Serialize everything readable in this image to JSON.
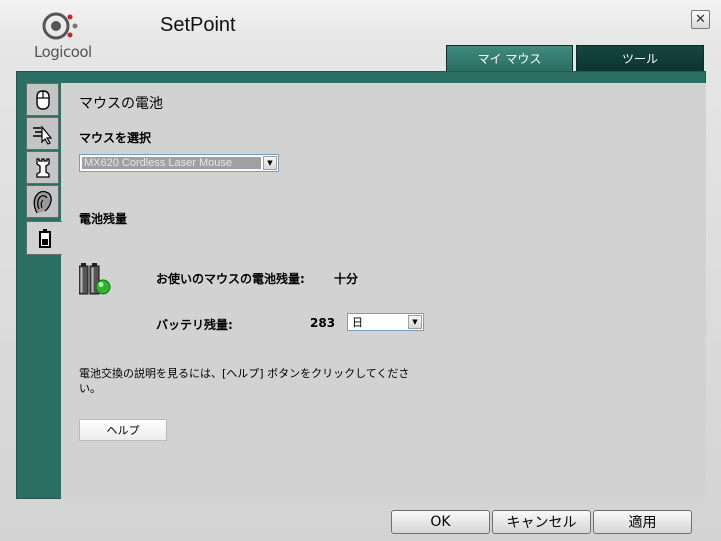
{
  "app": {
    "logo_text": "Logicool",
    "title": "SetPoint"
  },
  "tabs": [
    {
      "label": "マイ マウス",
      "active": true
    },
    {
      "label": "ツール",
      "active": false
    }
  ],
  "side_nav": [
    {
      "icon": "mouse-icon"
    },
    {
      "icon": "pointer-icon"
    },
    {
      "icon": "chess-rook-icon"
    },
    {
      "icon": "hand-icon"
    },
    {
      "icon": "battery-icon",
      "active": true
    }
  ],
  "page": {
    "title": "マウスの電池",
    "select_mouse_label": "マウスを選択",
    "selected_mouse": "MX620 Cordless Laser Mouse",
    "battery_section_label": "電池残量",
    "battery_status_label": "お使いのマウスの電池残量:",
    "battery_status_value": "十分",
    "battery_remaining_label": "バッテリ残量:",
    "battery_remaining_value": "283",
    "battery_unit": "日",
    "instructions_line1": "電池交換の説明を見るには、[ヘルプ] ボタンをクリックしてくださ",
    "instructions_line2": "い。",
    "help_button": "ヘルプ"
  },
  "footer": {
    "ok": "OK",
    "cancel": "キャンセル",
    "apply": "適用"
  },
  "colors": {
    "frame_teal": "#2b6e64",
    "tab_active": "#3f8a7e",
    "tab_inactive": "#15453f",
    "battery_ok": "#2db52d"
  }
}
